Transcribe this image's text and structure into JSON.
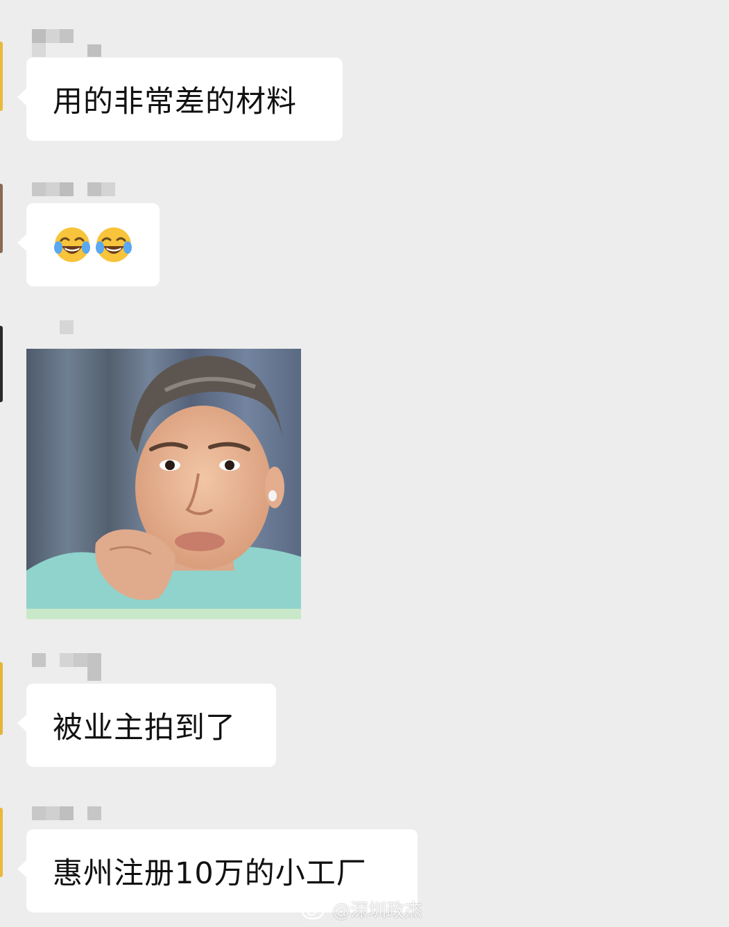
{
  "chat": {
    "messages": [
      {
        "sender": "",
        "text": "用的非常差的材料"
      },
      {
        "sender": "",
        "emoji": [
          "face-with-tears-of-joy",
          "face-with-tears-of-joy"
        ]
      },
      {
        "sender": "",
        "image": "man-with-hand-under-chin-photo"
      },
      {
        "sender": "",
        "text": "被业主拍到了"
      },
      {
        "sender": "",
        "text": "惠州注册10万的小工厂"
      }
    ]
  },
  "watermark": {
    "text": "@深圳政杰",
    "icon": "weibo-icon"
  },
  "colors": {
    "background": "#ededed",
    "bubble": "#ffffff",
    "text": "#111111"
  }
}
